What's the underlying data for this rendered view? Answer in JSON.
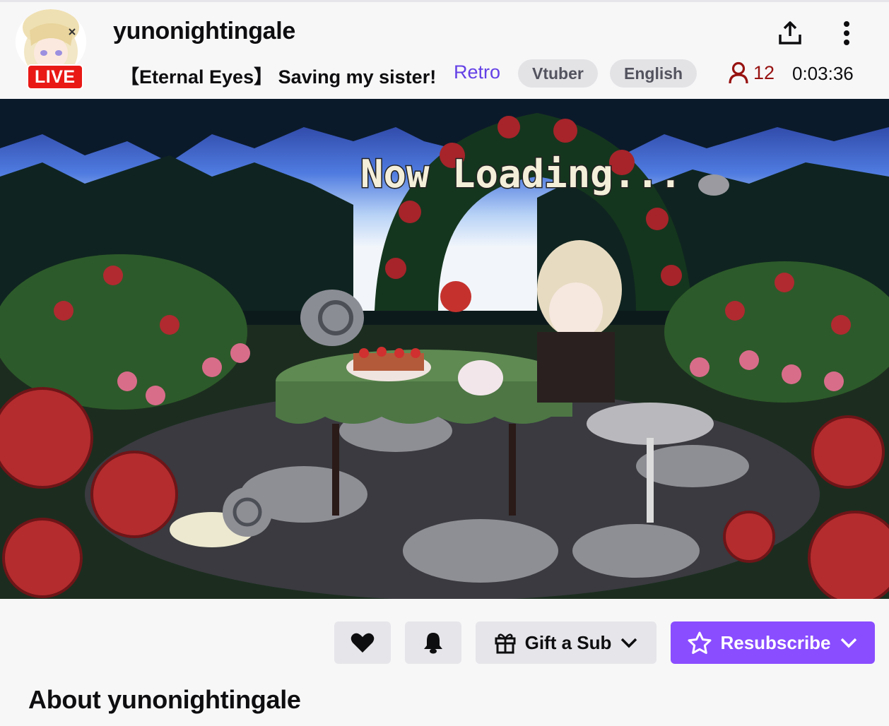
{
  "channel": {
    "name": "yunonightingale",
    "live_label": "LIVE"
  },
  "stream": {
    "title": "【Eternal Eyes】 Saving my sister!",
    "category": "Retro",
    "tags": [
      "Vtuber",
      "English"
    ],
    "viewer_count": "12",
    "uptime": "0:03:36"
  },
  "video": {
    "overlay_text": "Now Loading..."
  },
  "actions": {
    "gift_label": "Gift a Sub",
    "resubscribe_label": "Resubscribe"
  },
  "about": {
    "heading": "About yunonightingale"
  },
  "colors": {
    "live_red": "#e91916",
    "category_purple": "#6441e6",
    "viewer_red": "#971311",
    "resub_purple": "#8a4dff",
    "tag_bg": "#e3e3e6"
  },
  "icons": {
    "share": "share-icon",
    "more": "more-options-icon",
    "viewers": "person-icon",
    "follow": "heart-icon",
    "notify": "bell-icon",
    "gift": "gift-icon",
    "dropdown": "chevron-down-icon",
    "star": "star-icon"
  }
}
